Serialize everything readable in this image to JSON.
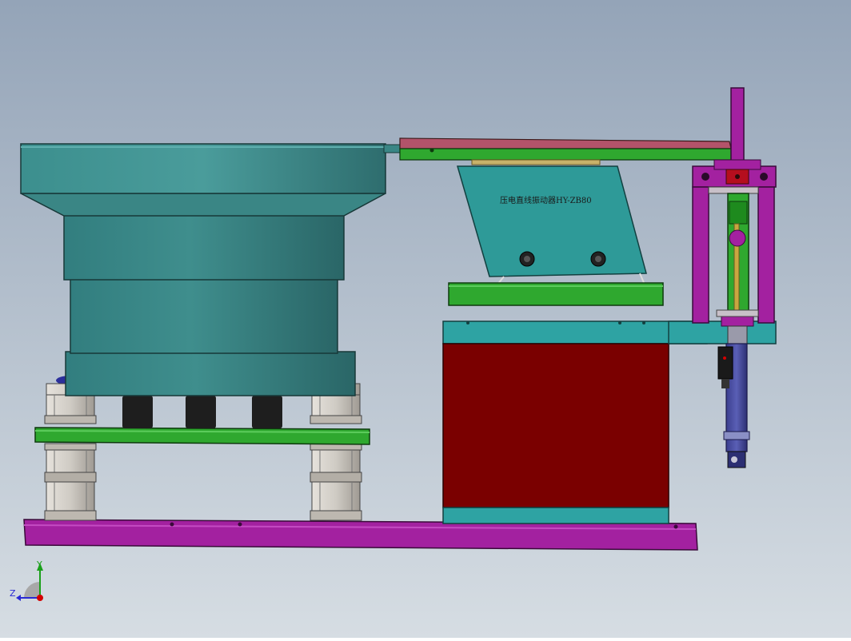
{
  "model": {
    "label_text": "压电直线振动器HY-ZB80"
  },
  "triad": {
    "y_label": "Y",
    "z_label": "Z"
  },
  "colors": {
    "background_top": "#94a4b8",
    "background_bottom": "#d6dde3",
    "bowl": "#3b8d8c",
    "bowl_dark": "#2f7373",
    "plate_green": "#2fa82f",
    "base_purple": "#a321a0",
    "housing_red": "#7a0000",
    "cyan_trim": "#2ea3a3",
    "nut": "#cfcbc4",
    "foot": "#1e1e1e"
  }
}
